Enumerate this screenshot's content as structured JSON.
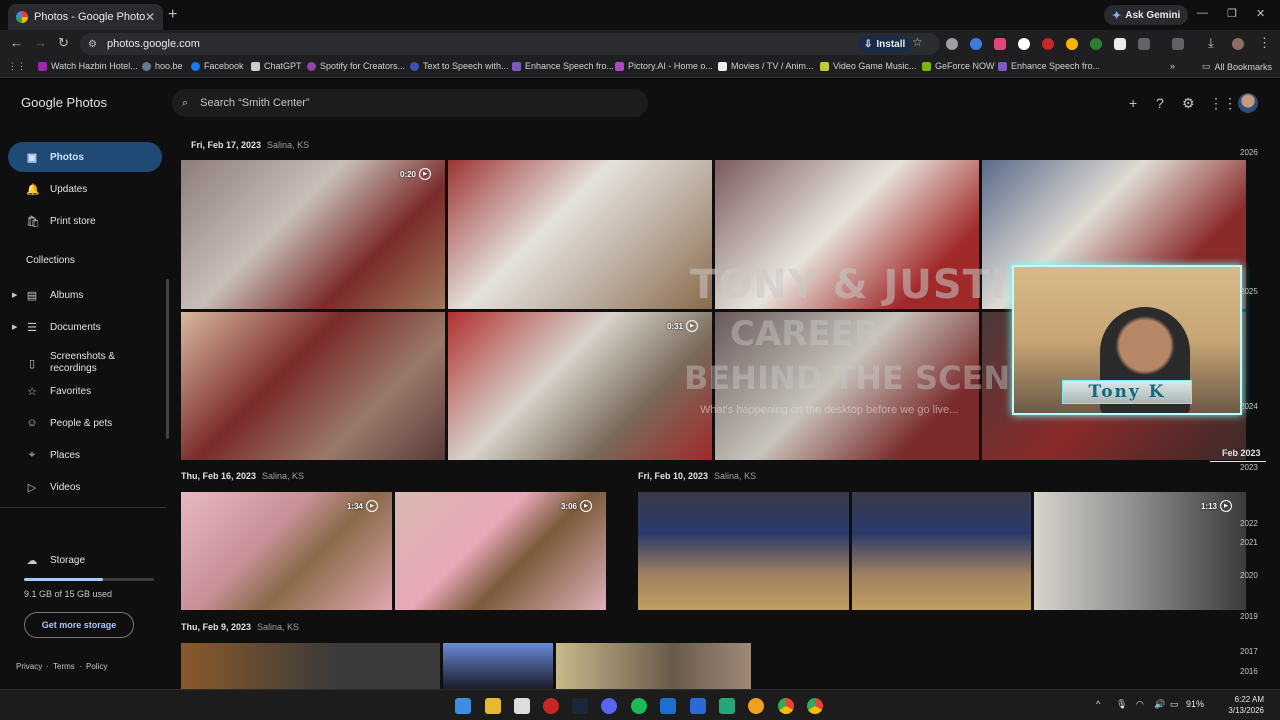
{
  "browser": {
    "tab_title": "Photos - Google Photos",
    "tab_close": "✕",
    "new_tab": "+",
    "ask_gemini": "Ask Gemini",
    "url": "photos.google.com",
    "install_label": "Install",
    "window_controls": [
      "—",
      "❐",
      "✕"
    ]
  },
  "bookmarks": [
    {
      "label": "Watch Hazbin Hotel...",
      "color": "#9c27b0"
    },
    {
      "label": "hoo.be",
      "color": "#607d8b"
    },
    {
      "label": "Facebook",
      "color": "#1877f2"
    },
    {
      "label": "ChatGPT",
      "color": "#cccccc"
    },
    {
      "label": "Spotify for Creators...",
      "color": "#8e44ad"
    },
    {
      "label": "Text to Speech with...",
      "color": "#3f51b5"
    },
    {
      "label": "Enhance Speech fro...",
      "color": "#7e57c2"
    },
    {
      "label": "Pictory.AI - Home o...",
      "color": "#ab47bc"
    },
    {
      "label": "Movies / TV / Anim...",
      "color": "#eeeeee"
    },
    {
      "label": "Video Game Music...",
      "color": "#c0ca33"
    },
    {
      "label": "GeForce NOW",
      "color": "#76b900"
    },
    {
      "label": "Enhance Speech fro...",
      "color": "#7e57c2"
    }
  ],
  "all_bookmarks": "All Bookmarks",
  "app": {
    "logo_google": "Google",
    "logo_photos": "Photos",
    "search_placeholder": "Search “Smith Center”"
  },
  "sidebar": {
    "items": [
      {
        "label": "Photos",
        "icon": "▣"
      },
      {
        "label": "Updates",
        "icon": "🔔"
      },
      {
        "label": "Print store",
        "icon": "🛍"
      }
    ],
    "collections_label": "Collections",
    "collections": [
      {
        "label": "Albums",
        "icon": "▤",
        "expandable": true
      },
      {
        "label": "Documents",
        "icon": "☰",
        "expandable": true
      },
      {
        "label": "Screenshots & recordings",
        "icon": "▯",
        "expandable": false
      },
      {
        "label": "Favorites",
        "icon": "☆",
        "expandable": false
      },
      {
        "label": "People & pets",
        "icon": "☺",
        "expandable": false
      },
      {
        "label": "Places",
        "icon": "⌖",
        "expandable": false
      },
      {
        "label": "Videos",
        "icon": "▷",
        "expandable": false
      }
    ],
    "storage_label": "Storage",
    "storage_used": "9.1 GB of 15 GB used",
    "storage_fraction": 0.607,
    "get_more": "Get more storage",
    "legal": [
      "Privacy",
      "·",
      "Terms",
      "·",
      "Policy"
    ]
  },
  "groups": [
    {
      "date": "Fri, Feb 17, 2023",
      "location": "Salina, KS"
    },
    {
      "date": "Thu, Feb 16, 2023",
      "location": "Salina, KS"
    },
    {
      "date": "Fri, Feb 10, 2023",
      "location": "Salina, KS"
    },
    {
      "date": "Thu, Feb 9, 2023",
      "location": "Salina, KS"
    }
  ],
  "durations": [
    "0:20",
    "0:31",
    "1:34",
    "3:06",
    "1:13"
  ],
  "timeline": {
    "years": [
      "2026",
      "2025",
      "2024",
      "2023",
      "2022",
      "2021",
      "2020",
      "2019",
      "2017",
      "2016"
    ],
    "current": "Feb 2023"
  },
  "overlay": {
    "title": "TONY & JUSTIN",
    "line1": "CAREER",
    "line2": "BEHIND THE SCENES",
    "tagline": "What's happening on the desktop before we go live...",
    "name": "Tony K"
  },
  "taskbar": {
    "battery": "91%",
    "time": "6:22 AM",
    "date": "3/13/2026"
  }
}
